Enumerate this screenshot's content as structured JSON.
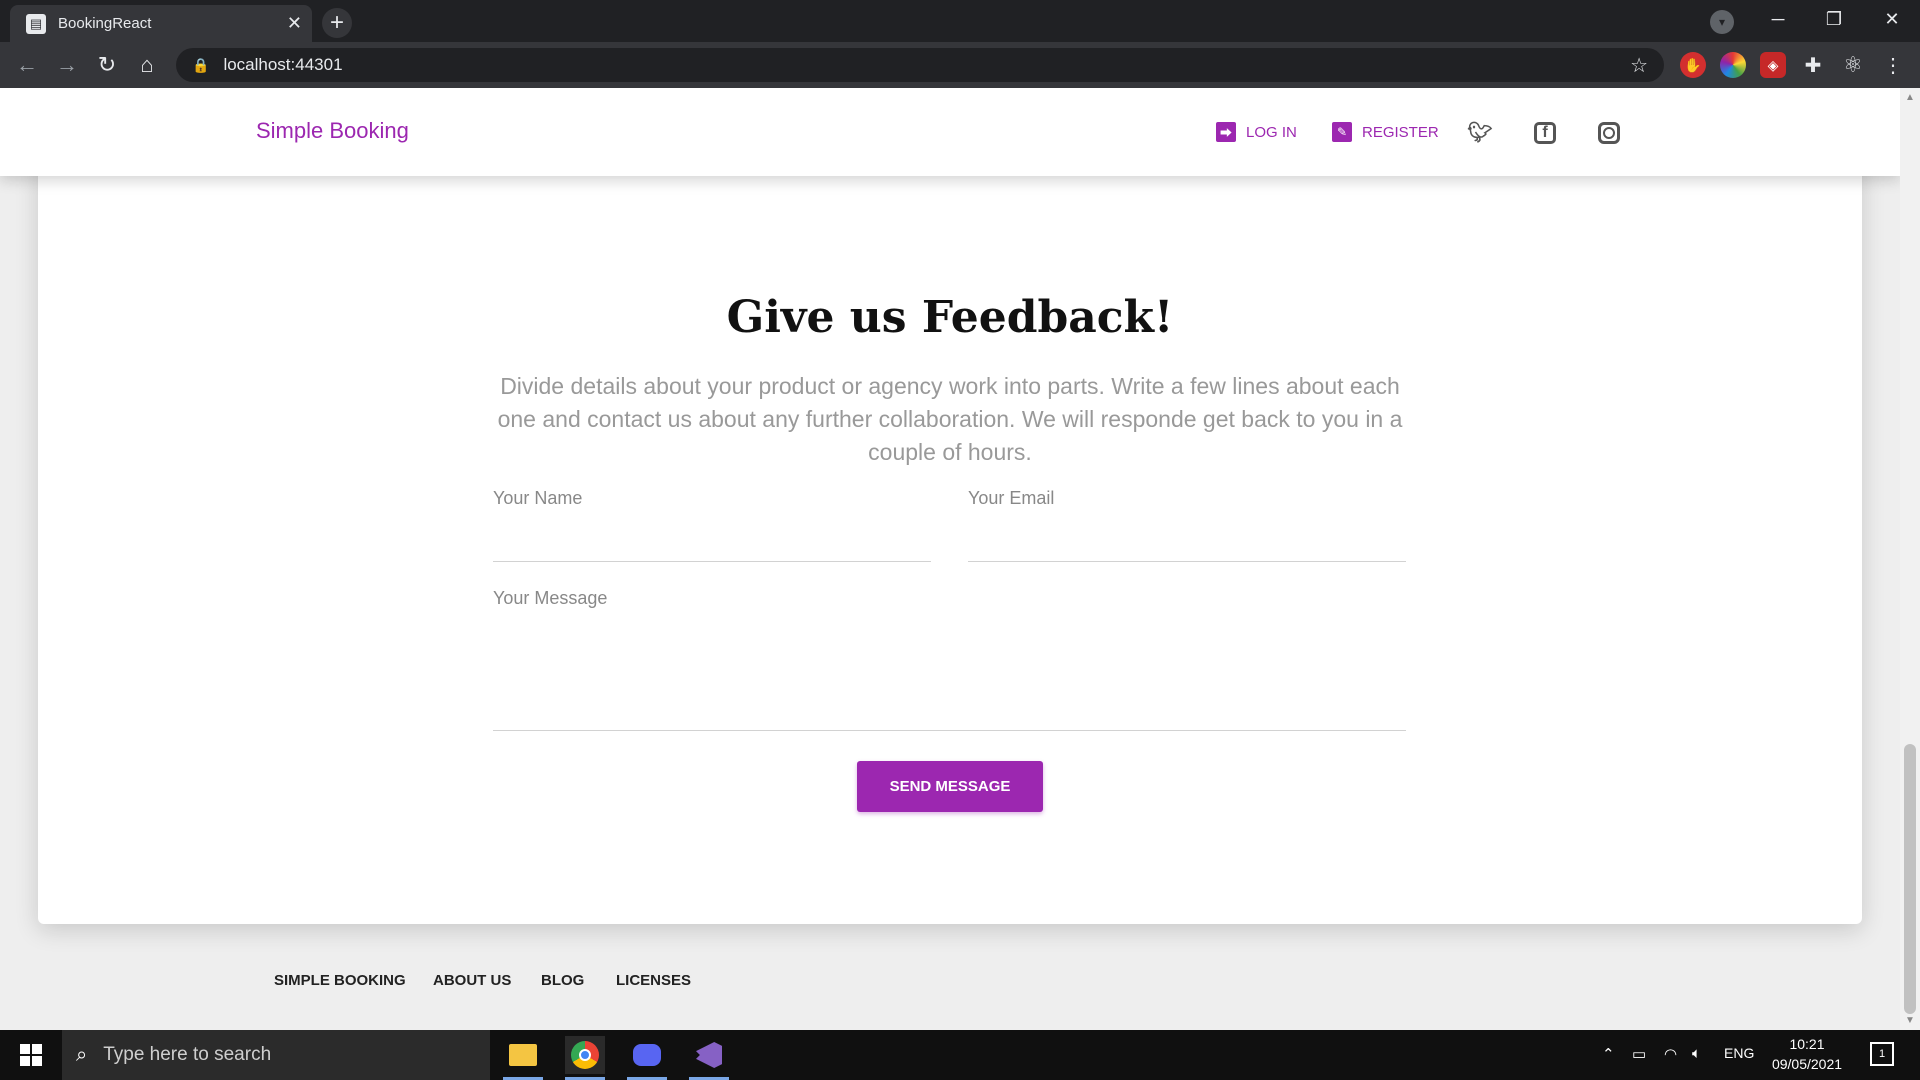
{
  "browser": {
    "tab_title": "BookingReact",
    "url": "localhost:44301"
  },
  "navbar": {
    "brand": "Simple Booking",
    "login": "LOG IN",
    "register": "REGISTER"
  },
  "feedback": {
    "title": "Give us Feedback!",
    "description": "Divide details about your product or agency work into parts. Write a few lines about each one and contact us about any further collaboration. We will responde get back to you in a couple of hours.",
    "name_label": "Your Name",
    "email_label": "Your Email",
    "message_label": "Your Message",
    "send_button": "SEND MESSAGE"
  },
  "footer": {
    "links": [
      "SIMPLE BOOKING",
      "ABOUT US",
      "BLOG",
      "LICENSES"
    ]
  },
  "taskbar": {
    "search_placeholder": "Type here to search",
    "language": "ENG",
    "time": "10:21",
    "date": "09/05/2021",
    "notification_count": "1"
  },
  "colors": {
    "accent": "#9c27b0",
    "browser_dark": "#202124",
    "browser_toolbar": "#35363a",
    "taskbar": "#101010"
  }
}
